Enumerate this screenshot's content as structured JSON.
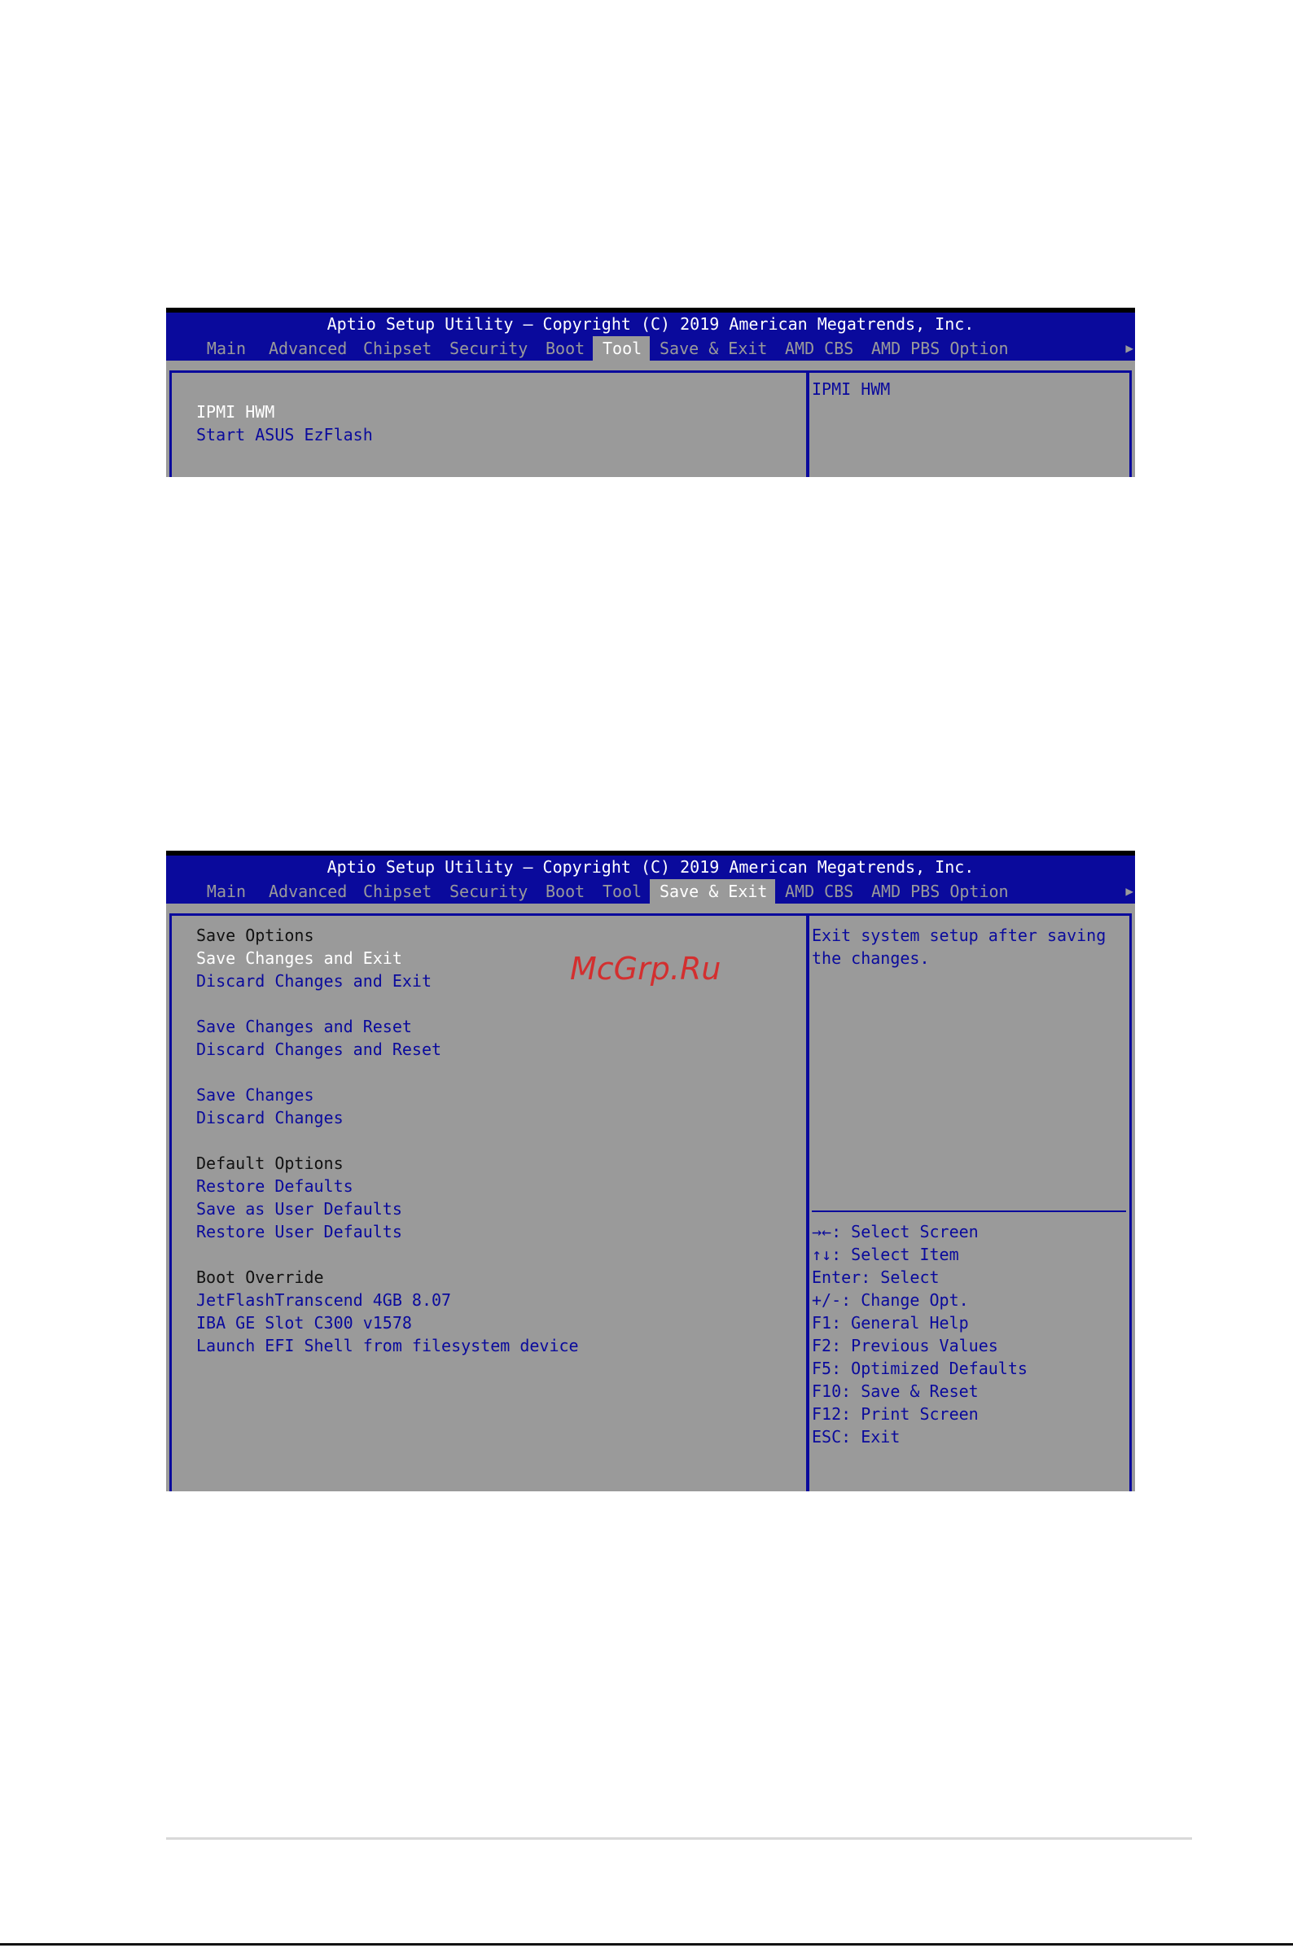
{
  "bios1": {
    "title": "Aptio Setup Utility – Copyright (C) 2019 American Megatrends, Inc.",
    "tabs": [
      "Main",
      "Advanced",
      "Chipset",
      "Security",
      "Boot",
      "Tool",
      "Save & Exit",
      "AMD CBS",
      "AMD PBS Option"
    ],
    "active_tab": "Tool",
    "items": [
      "IPMI HWM",
      "Start ASUS EzFlash"
    ],
    "help": "IPMI HWM"
  },
  "bios2": {
    "title": "Aptio Setup Utility – Copyright (C) 2019 American Megatrends, Inc.",
    "tabs": [
      "Main",
      "Advanced",
      "Chipset",
      "Security",
      "Boot",
      "Tool",
      "Save & Exit",
      "AMD CBS",
      "AMD PBS Option"
    ],
    "active_tab": "Save & Exit",
    "save_options_heading": "Save Options",
    "save_changes_and_exit": "Save Changes and Exit",
    "discard_changes_and_exit": "Discard Changes and Exit",
    "save_changes_and_reset": "Save Changes and Reset",
    "discard_changes_and_reset": "Discard Changes and Reset",
    "save_changes": "Save Changes",
    "discard_changes": "Discard Changes",
    "default_options_heading": "Default Options",
    "restore_defaults": "Restore Defaults",
    "save_as_user_defaults": "Save as User Defaults",
    "restore_user_defaults": "Restore User Defaults",
    "boot_override_heading": "Boot Override",
    "boot_items": [
      "JetFlashTranscend 4GB 8.07",
      "IBA GE Slot C300 v1578",
      "Launch EFI Shell from filesystem device"
    ],
    "help_text": [
      "Exit system setup after saving",
      "the changes."
    ],
    "keys": [
      "→←: Select Screen",
      "↑↓: Select Item",
      "Enter: Select",
      "+/-: Change Opt.",
      "F1: General Help",
      "F2: Previous Values",
      "F5: Optimized Defaults",
      "F10: Save & Reset",
      "F12: Print Screen",
      "ESC: Exit"
    ]
  },
  "watermark": "McGrp.Ru",
  "colors": {
    "bios_blue": "#0a0a9c",
    "bios_gray": "#9a9a9a",
    "watermark_red": "#d32f2f"
  }
}
